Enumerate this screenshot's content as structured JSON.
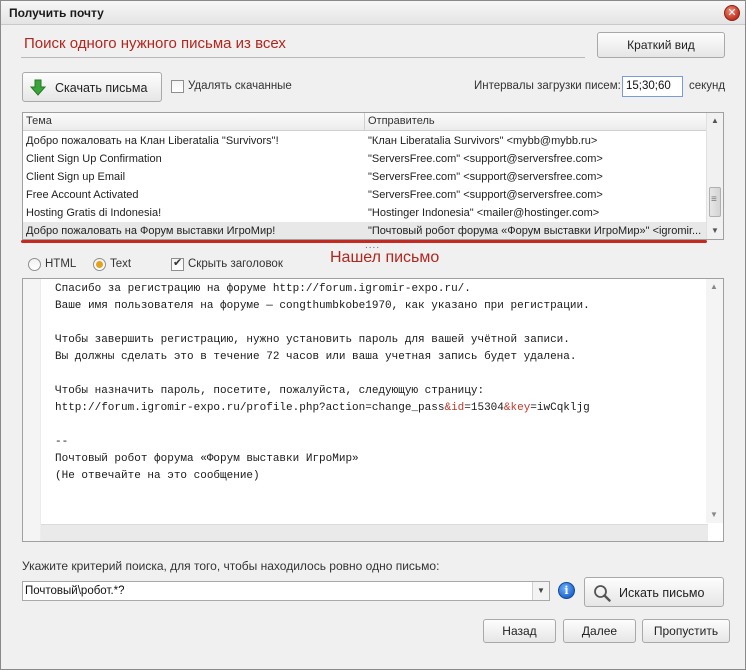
{
  "window": {
    "title": "Получить почту"
  },
  "header": {
    "heading": "Поиск одного нужного письма из всех",
    "brief_view_label": "Краткий вид"
  },
  "toolbar": {
    "download_label": "Скачать письма",
    "delete_downloaded_label": "Удалять скачанные",
    "delete_downloaded_checked": false,
    "interval_label": "Интервалы загрузки писем:",
    "interval_value": "15;30;60",
    "interval_unit": "секунд"
  },
  "table": {
    "columns": [
      "Тема",
      "Отправитель"
    ],
    "rows": [
      {
        "subject": "Добро пожаловать на Клан Liberatalia \"Survivors\"!",
        "sender": "\"Клан Liberatalia Survivors\" <mybb@mybb.ru>"
      },
      {
        "subject": "Client Sign Up Confirmation",
        "sender": "\"ServersFree.com\" <support@serversfree.com>"
      },
      {
        "subject": "Client Sign up Email",
        "sender": "\"ServersFree.com\" <support@serversfree.com>"
      },
      {
        "subject": "Free Account Activated",
        "sender": "\"ServersFree.com\" <support@serversfree.com>"
      },
      {
        "subject": "Hosting Gratis di Indonesia!",
        "sender": "\"Hostinger Indonesia\" <mailer@hostinger.com>"
      },
      {
        "subject": "Добро пожаловать на Форум выставки ИгроМир!",
        "sender": "\"Почтовый робот форума «Форум выставки ИгроМир»\" <igromir..."
      }
    ],
    "selected_row": 5,
    "more_indicator": "....",
    "scroll_up": "▲",
    "scroll_down": "▼"
  },
  "view_options": {
    "html_label": "HTML",
    "text_label": "Text",
    "selected": "text",
    "hide_header_label": "Скрыть заголовок",
    "hide_header_checked": true
  },
  "annotation": "Нашел письмо",
  "message": {
    "lines": [
      "Спасибо за регистрацию на форуме http://forum.igromir-expo.ru/.",
      "Ваше имя пользователя на форуме — congthumbkobe1970, как указано при регистрации.",
      "",
      "Чтобы завершить регистрацию, нужно установить пароль для вашей учётной записи.",
      "Вы должны сделать это в течение 72 часов или ваша учетная запись будет удалена.",
      "",
      "Чтобы назначить пароль, посетите, пожалуйста, следующую страницу:",
      "",
      "",
      "--",
      "Почтовый робот форума «Форум выставки ИгроМир»",
      "(Не отвечайте на это сообщение)"
    ],
    "link_parts": [
      "http://forum.igromir-expo.ru/profile.php?action=change_pass",
      "&id",
      "=15304",
      "&key",
      "=iwCqkljg"
    ],
    "scroll_up": "▲",
    "scroll_down": "▼"
  },
  "search": {
    "criteria_label": "Укажите критерий поиска, для того, чтобы находилось ровно одно письмо:",
    "criteria_value": "Почтовый\\робот.*?",
    "combo_arrow": "▼",
    "info_glyph": "i",
    "search_button_label": "Искать письмо"
  },
  "nav": {
    "back_label": "Назад",
    "next_label": "Далее",
    "skip_label": "Пропустить"
  },
  "colors": {
    "accent_red": "#b3261e",
    "selection_underline": "#c32a22",
    "download_green": "#3aa53a"
  }
}
